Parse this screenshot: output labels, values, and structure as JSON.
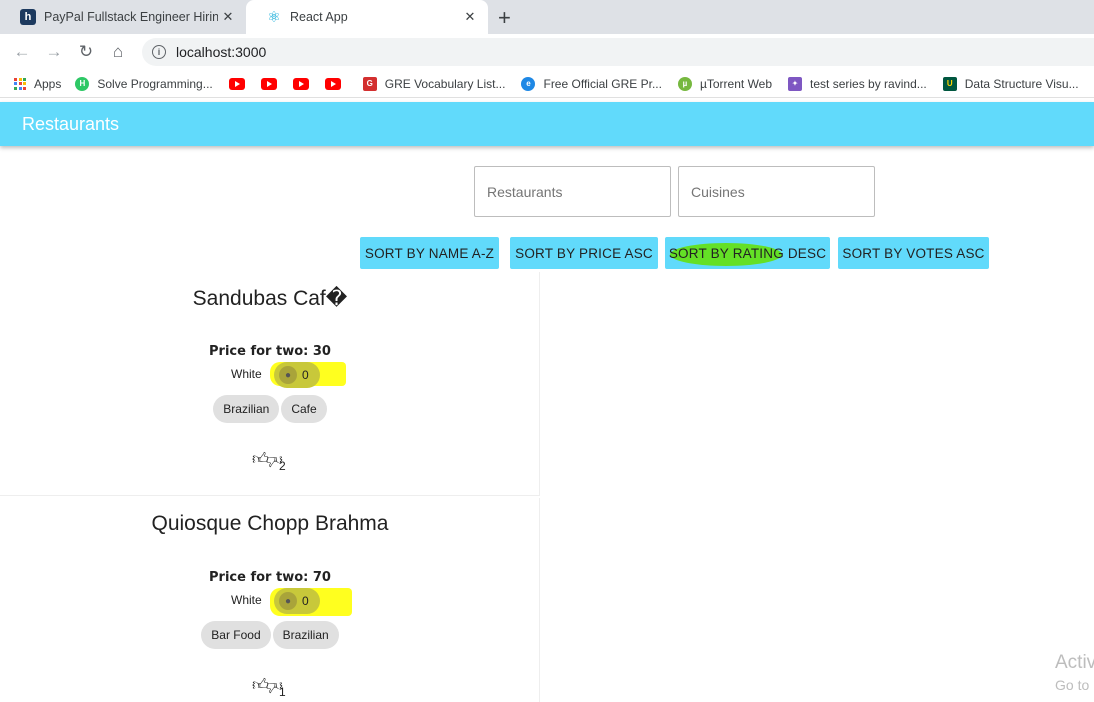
{
  "browser": {
    "tabs": [
      {
        "title": "PayPal Fullstack Engineer Hiring C",
        "icon": "hackerrank-icon"
      },
      {
        "title": "React App",
        "icon": "react-icon"
      }
    ],
    "new_tab": "+",
    "close": "✕",
    "url": "localhost:3000",
    "bookmarks": [
      {
        "label": "Apps",
        "icon": "apps-grid-icon"
      },
      {
        "label": "Solve Programming...",
        "icon": "hackerrank-icon"
      },
      {
        "label": "",
        "icon": "youtube-icon"
      },
      {
        "label": "",
        "icon": "youtube-icon"
      },
      {
        "label": "",
        "icon": "youtube-icon"
      },
      {
        "label": "",
        "icon": "youtube-icon"
      },
      {
        "label": "GRE Vocabulary List...",
        "icon": "gre-icon"
      },
      {
        "label": "Free Official GRE Pr...",
        "icon": "ets-icon"
      },
      {
        "label": "µTorrent Web",
        "icon": "utorrent-icon"
      },
      {
        "label": "test series by ravind...",
        "icon": "butterfly-icon"
      },
      {
        "label": "Data Structure Visu...",
        "icon": "usf-icon"
      }
    ]
  },
  "app": {
    "title": "Restaurants",
    "search": {
      "restaurants_placeholder": "Restaurants",
      "cuisines_placeholder": "Cuisines"
    },
    "sort_buttons": [
      "SORT BY NAME A-Z",
      "SORT BY PRICE ASC",
      "SORT BY RATING DESC",
      "SORT BY VOTES ASC"
    ],
    "restaurants": [
      {
        "name": "Sandubas Caf�",
        "price": "Price for two: 30",
        "rating_text": "White",
        "votes": "0",
        "cuisines": [
          "Brazilian",
          "Cafe"
        ],
        "likes": "2"
      },
      {
        "name": "Quiosque Chopp Brahma",
        "price": "Price for two: 70",
        "rating_text": "White",
        "votes": "0",
        "cuisines": [
          "Bar Food",
          "Brazilian"
        ],
        "likes": "1"
      }
    ],
    "watermark": {
      "line1": "Activ",
      "line2": "Go to"
    }
  }
}
